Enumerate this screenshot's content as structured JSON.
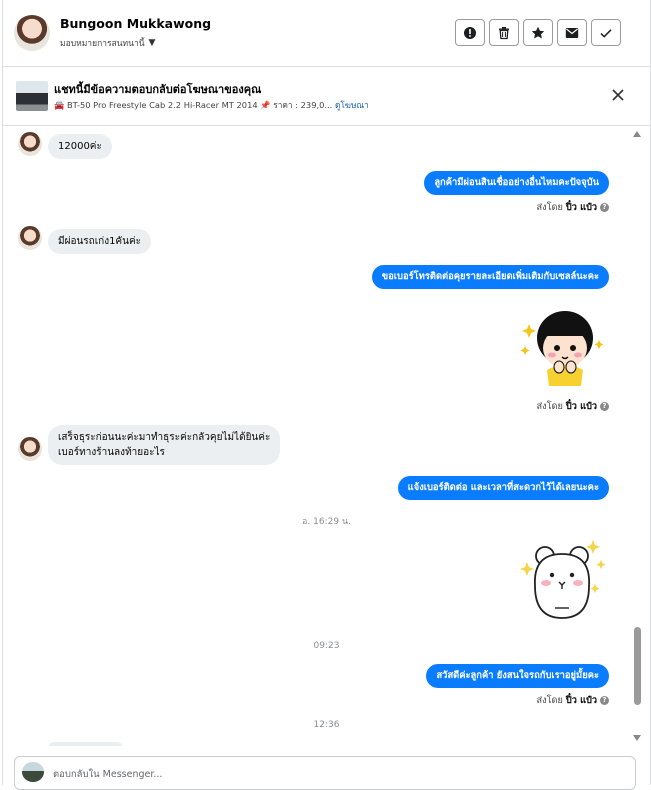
{
  "header": {
    "name": "Bungoon Mukkawong",
    "assign_label": "มอบหมายการสนทนานี้"
  },
  "ad": {
    "title": "แชทนี้มีข้อความตอบกลับต่อโฆษณาของคุณ",
    "car_name": "BT-50 Pro Freestyle Cab 2.2 Hi-Racer MT 2014",
    "price": "ราคา : 239,0...",
    "link": "ดูโฆษณา"
  },
  "messages": [
    {
      "dir": "in",
      "text": "12000ค่ะ"
    },
    {
      "dir": "out",
      "text": "ลูกค้ามีผ่อนสินเชื่ออย่างอื่นไหมคะปัจจุบัน"
    },
    {
      "dir": "in",
      "text": "มีผ่อนรถเก่ง1คันค่ะ"
    },
    {
      "dir": "out",
      "text": "ขอเบอร์โทรติดต่อคุยรายละเอียดเพิ่มเติมกับเซลล์นะคะ"
    },
    {
      "dir": "in",
      "line1": "เสร็จธุระก่อนนะค่ะมาทำธุระค่ะกลัวคุยไม่ได้ยินค่ะ",
      "line2": "เบอร์ทางร้านลงท้ายอะไร"
    },
    {
      "dir": "out",
      "text": "แจ้งเบอร์ติดต่อ  และเวลาที่สะดวกไว้ได้เลยนะคะ"
    },
    {
      "dir": "out",
      "text": "สวัสดีค่ะลูกค้า ยังสนใจรถกับเราอยู่มั้ยคะ"
    }
  ],
  "sent_by": {
    "prefix": "ส่งโดย",
    "name": "ปิ๋ว แป๋ว"
  },
  "times": {
    "t1": "อ. 16:29 น.",
    "t2": "09:23",
    "t3": "12:36"
  },
  "composer": {
    "placeholder": "ตอบกลับใน Messenger..."
  },
  "colors": {
    "outgoing": "#0a7cff",
    "incoming": "#eceff1",
    "link": "#1a5fb4"
  }
}
